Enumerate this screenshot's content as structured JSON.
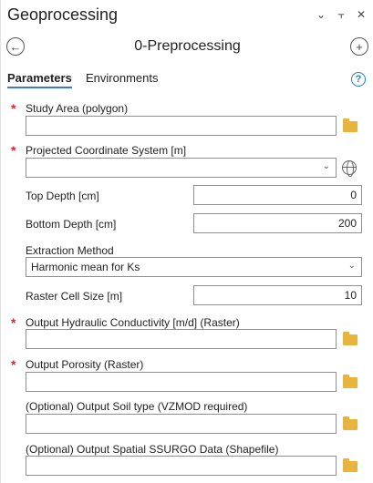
{
  "window": {
    "title": "Geoprocessing",
    "controls": [
      "⌄",
      "⫟",
      "✕"
    ]
  },
  "tool": {
    "name": "0-Preprocessing",
    "back_icon": "back-arrow-icon",
    "add_icon": "add-icon"
  },
  "tabs": {
    "parameters": "Parameters",
    "environments": "Environments",
    "help": "?"
  },
  "params": {
    "study_area": {
      "label": "Study Area (polygon)",
      "required": true,
      "value": ""
    },
    "proj_coord": {
      "label": "Projected Coordinate System [m]",
      "required": true,
      "value": ""
    },
    "top_depth": {
      "label": "Top Depth [cm]",
      "value": "0"
    },
    "bottom_depth": {
      "label": "Bottom Depth [cm]",
      "value": "200"
    },
    "extraction": {
      "label": "Extraction Method",
      "value": "Harmonic mean for Ks"
    },
    "cell_size": {
      "label": "Raster Cell Size [m]",
      "value": "10"
    },
    "out_ks": {
      "label": "Output Hydraulic Conductivity [m/d] (Raster)",
      "required": true,
      "value": ""
    },
    "out_porosity": {
      "label": "Output Porosity (Raster)",
      "required": true,
      "value": ""
    },
    "out_soil": {
      "label": "(Optional) Output Soil type (VZMOD required)",
      "value": ""
    },
    "out_ssurgo": {
      "label": "(Optional) Output Spatial SSURGO Data (Shapefile)",
      "value": ""
    }
  },
  "required_marker": "*",
  "colors": {
    "accent": "#3a7ad2",
    "required": "#dd2233",
    "folder": "#e7b43d"
  }
}
